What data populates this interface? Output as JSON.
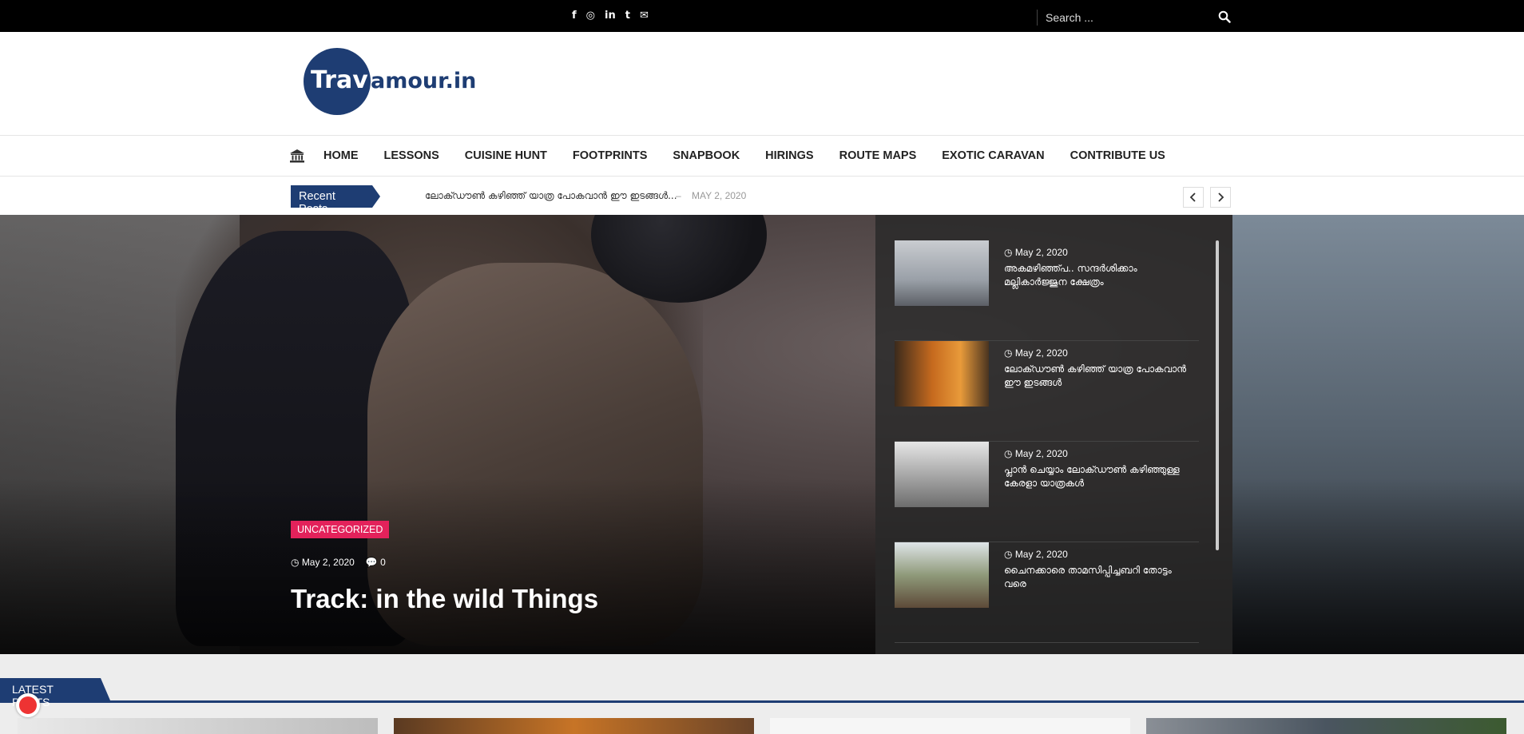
{
  "topbar": {
    "social_icons": [
      "facebook-icon",
      "instagram-icon",
      "linkedin-icon",
      "tumblr-icon",
      "email-icon"
    ],
    "social_glyphs": [
      "f",
      "◎",
      "in",
      "t",
      "✉"
    ],
    "search_placeholder": "Search ..."
  },
  "logo": {
    "part1": "Trav",
    "part2": "amour.in"
  },
  "nav": {
    "items": [
      "HOME",
      "LESSONS",
      "CUISINE HUNT",
      "FOOTPRINTS",
      "SNAPBOOK",
      "HIRINGS",
      "ROUTE MAPS",
      "EXOTIC CARAVAN",
      "CONTRIBUTE US"
    ]
  },
  "ticker": {
    "label": "Recent Posts",
    "title": "ലോക്ഡൗൺ കഴിഞ്ഞ് യാത്ര പോകവാൻ ഈ ഇടങ്ങൾ...",
    "dash": "–",
    "date": "MAY 2, 2020"
  },
  "hero": {
    "category": "UNCATEGORIZED",
    "date": "May 2, 2020",
    "comments": "0",
    "title": "Track: in the wild Things"
  },
  "side_posts": [
    {
      "date": "May 2, 2020",
      "title": "അകമഴിഞ്ഞ്പ.. സന്ദർശിക്കാം മല്ലികാർജ്ജുന ക്ഷേത്രം"
    },
    {
      "date": "May 2, 2020",
      "title": "ലോക്ഡൗൺ കഴിഞ്ഞ് യാത്ര പോകവാൻ ഈ ഇടങ്ങൾ"
    },
    {
      "date": "May 2, 2020",
      "title": "പ്ലാൻ ചെയ്യാം ലോക്ഡൗൺ കഴിഞ്ഞുള്ള കേരളാ യാത്രകൾ"
    },
    {
      "date": "May 2, 2020",
      "title": "ചൈനക്കാരെ താമസിപ്പിച്ചബറി തോട്ടം വരെ"
    }
  ],
  "latest": {
    "label": "LATEST POSTS"
  },
  "colors": {
    "brand": "#1e3d73",
    "badge": "#e3225b",
    "topbar": "#000000"
  }
}
